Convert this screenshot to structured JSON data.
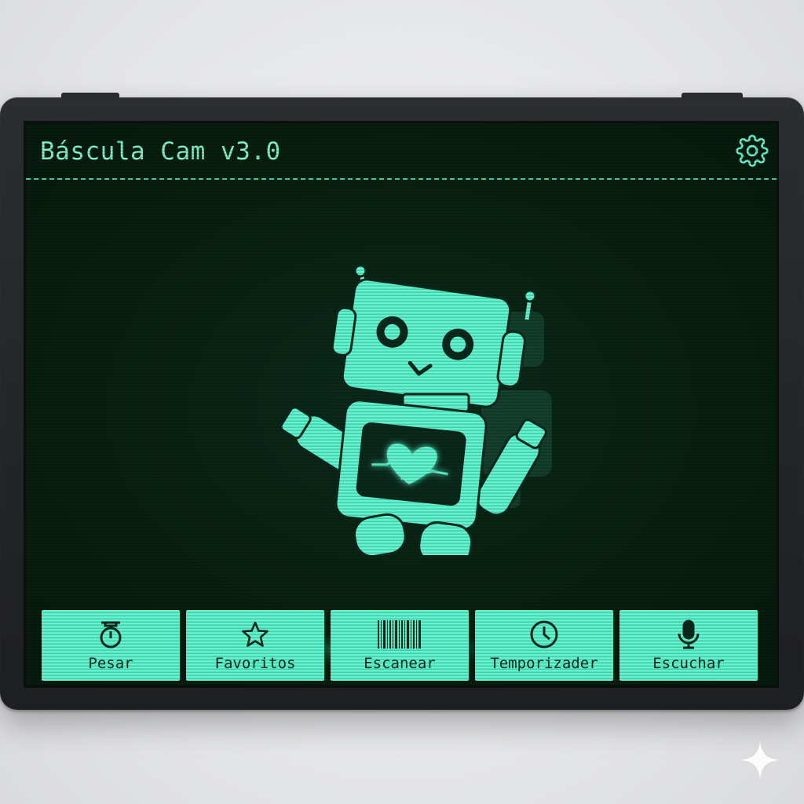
{
  "app": {
    "title": "Báscula Cam v3.0",
    "accent_color": "#5ef5cf",
    "screen_bg": "#08200f"
  },
  "header": {
    "settings_icon": "gear-icon"
  },
  "mascot": {
    "icon": "robot-icon",
    "chest_icon": "heart-pulse-icon"
  },
  "toolbar": {
    "buttons": [
      {
        "label": "Pesar",
        "icon": "scale-icon"
      },
      {
        "label": "Favoritos",
        "icon": "star-icon"
      },
      {
        "label": "Escanear",
        "icon": "barcode-icon"
      },
      {
        "label": "Temporizader",
        "icon": "clock-icon"
      },
      {
        "label": "Escuchar",
        "icon": "microphone-icon"
      }
    ]
  }
}
